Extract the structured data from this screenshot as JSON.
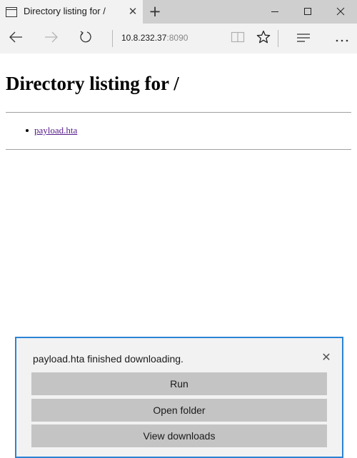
{
  "tab": {
    "title": "Directory listing for /",
    "close_glyph": "✕",
    "icon": "page-icon"
  },
  "new_tab_glyph": "+",
  "window_controls": {
    "minimize_icon": "minimize-icon",
    "maximize_icon": "maximize-icon",
    "close_icon": "close-icon"
  },
  "navbar": {
    "url_host": "10.8.232.37",
    "url_port": ":8090",
    "icons": [
      "back-arrow-icon",
      "forward-arrow-icon",
      "refresh-icon",
      "reading-view-icon",
      "favorite-star-icon",
      "hub-icon",
      "more-icon"
    ]
  },
  "page": {
    "heading": "Directory listing for /",
    "files": [
      "payload.hta"
    ]
  },
  "download": {
    "message": "payload.hta finished downloading.",
    "close_glyph": "✕",
    "run_label": "Run",
    "open_folder_label": "Open folder",
    "view_downloads_label": "View downloads"
  },
  "colors": {
    "accent": "#2b83d4",
    "visited_link": "#551a8b",
    "chrome_bg": "#f2f2f2",
    "titlebar_bg": "#cfcfcf"
  }
}
